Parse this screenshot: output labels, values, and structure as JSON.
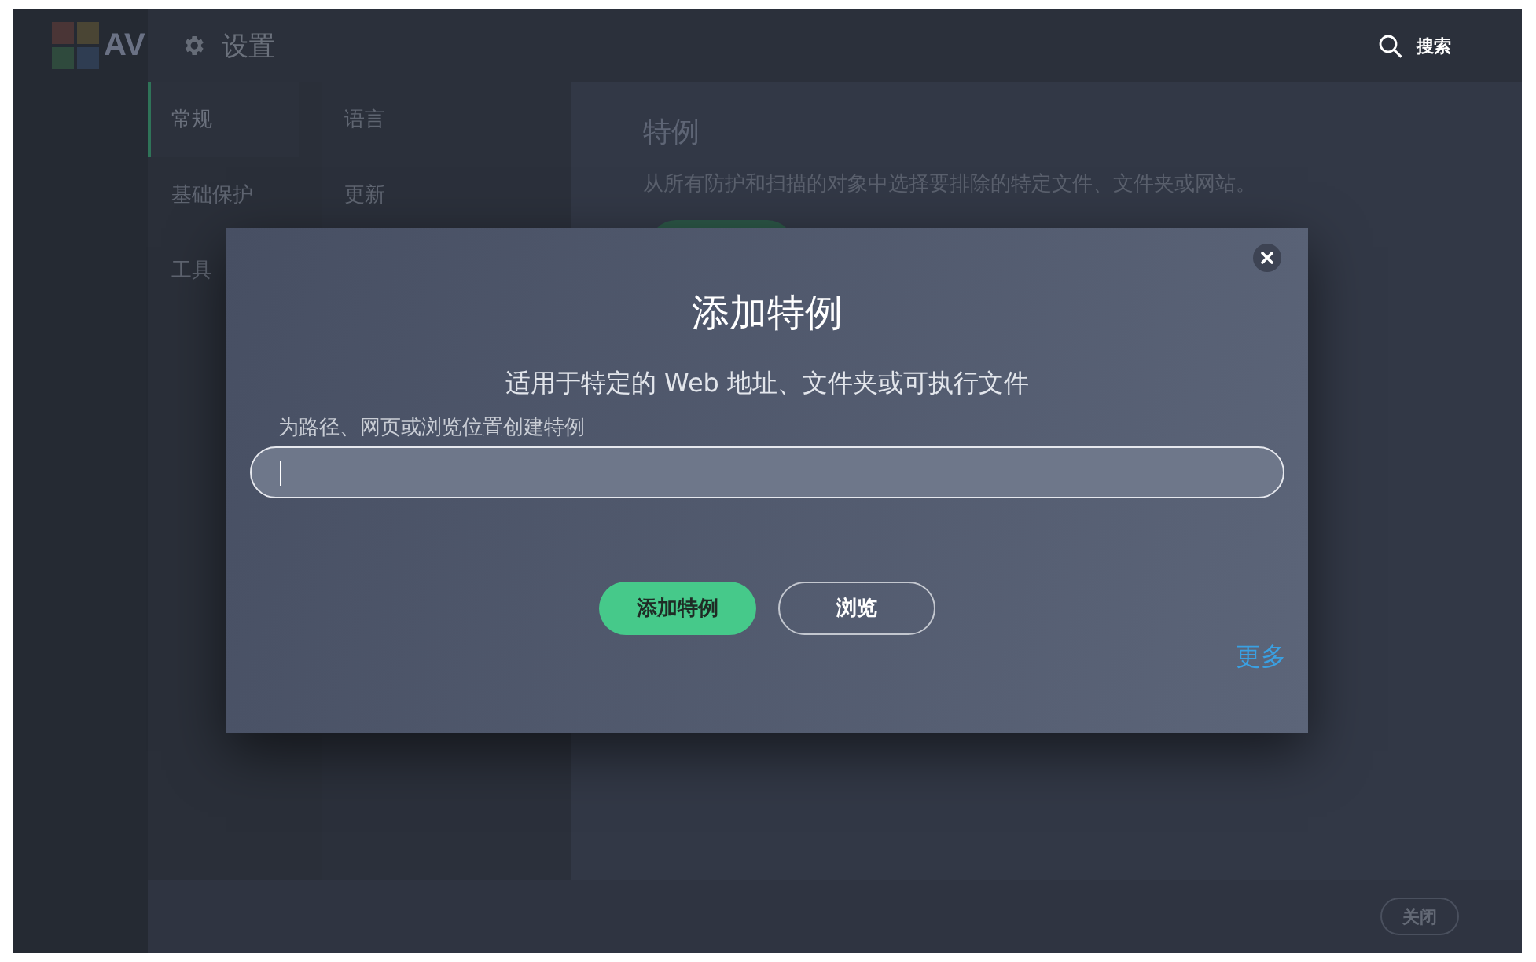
{
  "window": {
    "logo": "AV"
  },
  "header": {
    "title": "设置",
    "search": "搜索"
  },
  "sidebar": {
    "items": [
      {
        "label": "常规",
        "selected": true
      },
      {
        "label": "基础保护",
        "selected": false
      },
      {
        "label": "工具",
        "selected": false
      }
    ]
  },
  "subnav": {
    "items": [
      {
        "label": "语言",
        "selected": false
      },
      {
        "label": "更新",
        "selected": false
      }
    ]
  },
  "content": {
    "title": "特例",
    "description": "从所有防护和扫描的对象中选择要排除的特定文件、文件夹或网站。"
  },
  "dialog": {
    "title": "添加特例",
    "subtitle": "适用于特定的 Web 地址、文件夹或可执行文件",
    "field": {
      "label": "为路径、网页或浏览位置创建特例",
      "focused": true
    },
    "buttons": [
      {
        "label": "添加特例",
        "kind": "primary"
      },
      {
        "label": "浏览",
        "kind": "outline"
      }
    ],
    "link": "更多"
  },
  "footer": {
    "close_button": "关闭"
  }
}
